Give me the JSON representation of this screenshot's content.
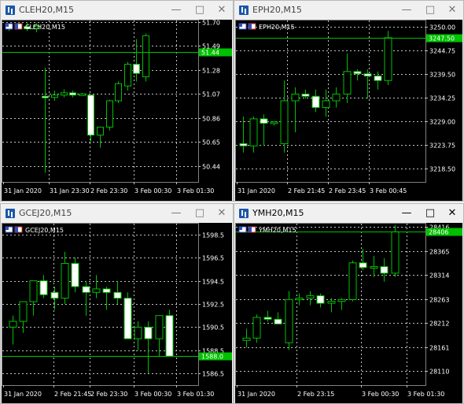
{
  "windows": [
    {
      "title": "CLEH20,M15",
      "chart_label": "CLEH20,M15",
      "price_ticks": [
        "51.70",
        "51.49",
        "51.28",
        "51.07",
        "50.86",
        "50.65",
        "50.44"
      ],
      "time_ticks": [
        "31 Jan 2020",
        "31 Jan 23:30",
        "2 Feb 23:30",
        "3 Feb 00:30",
        "3 Feb 01:30"
      ],
      "current_price": "51.44",
      "active": false
    },
    {
      "title": "EPH20,M15",
      "chart_label": "EPH20,M15",
      "price_ticks": [
        "3250.00",
        "3244.75",
        "3239.50",
        "3234.25",
        "3229.00",
        "3223.75",
        "3218.50"
      ],
      "time_ticks": [
        "31 Jan 2020",
        "2 Feb 21:45",
        "2 Feb 23:45",
        "3 Feb 00:45"
      ],
      "current_price": "3247.50",
      "active": false
    },
    {
      "title": "GCEJ20,M15",
      "chart_label": "GCEJ20,M15",
      "price_ticks": [
        "1598.5",
        "1596.5",
        "1594.5",
        "1592.5",
        "1590.5",
        "1588.5",
        "1586.5"
      ],
      "time_ticks": [
        "31 Jan 2020",
        "2 Feb 21:45",
        "2 Feb 23:30",
        "3 Feb 00:30",
        "3 Feb 01:30"
      ],
      "current_price": "1588.0",
      "active": false
    },
    {
      "title": "YMH20,M15",
      "chart_label": "YMH20,M15",
      "price_ticks": [
        "28416",
        "28365",
        "28314",
        "28263",
        "28212",
        "28161",
        "28110"
      ],
      "time_ticks": [
        "31 Jan 2020",
        "2 Feb 23:15",
        "3 Feb 00:30",
        "3 Feb 01:30"
      ],
      "current_price": "28406",
      "active": true
    }
  ],
  "chart_data": [
    {
      "type": "candlestick",
      "title": "CLEH20,M15",
      "y_range": [
        50.3,
        51.72
      ],
      "current_price": 51.44,
      "candles": [
        [
          51.65,
          51.69,
          51.62,
          51.67
        ],
        [
          51.67,
          51.7,
          51.64,
          51.66
        ],
        [
          51.66,
          51.7,
          51.62,
          51.64
        ],
        [
          51.64,
          51.69,
          51.61,
          51.67
        ],
        [
          51.05,
          51.3,
          50.38,
          51.04
        ],
        [
          51.04,
          51.1,
          51.01,
          51.06
        ],
        [
          51.06,
          51.11,
          51.04,
          51.08
        ],
        [
          51.08,
          51.1,
          51.04,
          51.06
        ],
        [
          51.07,
          51.08,
          51.06,
          51.07
        ],
        [
          51.06,
          51.06,
          50.65,
          50.71
        ],
        [
          50.71,
          50.78,
          50.6,
          50.78
        ],
        [
          50.78,
          51.02,
          50.75,
          51.01
        ],
        [
          51.01,
          51.18,
          50.99,
          51.16
        ],
        [
          51.14,
          51.35,
          51.1,
          51.33
        ],
        [
          51.33,
          51.55,
          51.18,
          51.25
        ],
        [
          51.22,
          51.6,
          51.18,
          51.58
        ]
      ]
    },
    {
      "type": "candlestick",
      "title": "EPH20,M15",
      "y_range": [
        3215.5,
        3251.5
      ],
      "current_price": 3247.5,
      "candles": [
        [
          3224.0,
          3230.0,
          3222.0,
          3223.5
        ],
        [
          3223.5,
          3230.0,
          3222.0,
          3229.5
        ],
        [
          3229.5,
          3230.5,
          3223.5,
          3228.5
        ],
        [
          3228.5,
          3229.0,
          3228.0,
          3228.8
        ],
        [
          3224.0,
          3238.0,
          3222.0,
          3233.5
        ],
        [
          3233.5,
          3236.5,
          3226.5,
          3235.0
        ],
        [
          3235.0,
          3236.0,
          3234.0,
          3234.5
        ],
        [
          3234.5,
          3236.0,
          3231.0,
          3232.0
        ],
        [
          3232.0,
          3236.0,
          3230.0,
          3233.5
        ],
        [
          3233.5,
          3236.5,
          3232.0,
          3235.0
        ],
        [
          3235.0,
          3244.0,
          3233.0,
          3240.0
        ],
        [
          3240.0,
          3240.5,
          3238.0,
          3239.5
        ],
        [
          3239.5,
          3240.5,
          3234.0,
          3239.0
        ],
        [
          3239.0,
          3240.0,
          3236.0,
          3238.0
        ],
        [
          3238.0,
          3249.0,
          3237.0,
          3247.5
        ]
      ]
    },
    {
      "type": "candlestick",
      "title": "GCEJ20,M15",
      "y_range": [
        1585.5,
        1599.5
      ],
      "current_price": 1588.0,
      "candles": [
        [
          1590.5,
          1591.5,
          1589.0,
          1591.0
        ],
        [
          1591.0,
          1592.5,
          1590.0,
          1592.7
        ],
        [
          1592.7,
          1594.5,
          1591.5,
          1594.5
        ],
        [
          1594.5,
          1595.0,
          1593.0,
          1593.3
        ],
        [
          1593.5,
          1594.0,
          1592.0,
          1593.0
        ],
        [
          1593.0,
          1597.0,
          1592.5,
          1596.0
        ],
        [
          1596.0,
          1596.5,
          1593.5,
          1594.0
        ],
        [
          1594.0,
          1594.5,
          1591.5,
          1593.5
        ],
        [
          1593.5,
          1595.0,
          1593.0,
          1593.8
        ],
        [
          1593.8,
          1594.0,
          1592.0,
          1593.5
        ],
        [
          1593.5,
          1594.5,
          1592.5,
          1593.0
        ],
        [
          1593.0,
          1593.5,
          1589.5,
          1589.5
        ],
        [
          1589.5,
          1591.0,
          1588.5,
          1590.5
        ],
        [
          1590.5,
          1591.0,
          1586.5,
          1589.5
        ],
        [
          1589.5,
          1591.0,
          1588.0,
          1591.5
        ],
        [
          1591.5,
          1592.0,
          1588.0,
          1588.0
        ]
      ]
    },
    {
      "type": "candlestick",
      "title": "YMH20,M15",
      "y_range": [
        28080,
        28425
      ],
      "current_price": 28406,
      "candles": [
        [
          28175,
          28200,
          28160,
          28180
        ],
        [
          28180,
          28230,
          28170,
          28224
        ],
        [
          28224,
          28238,
          28215,
          28220
        ],
        [
          28220,
          28235,
          28210,
          28210
        ],
        [
          28170,
          28280,
          28155,
          28262
        ],
        [
          28262,
          28275,
          28250,
          28265
        ],
        [
          28265,
          28280,
          28250,
          28270
        ],
        [
          28270,
          28275,
          28245,
          28254
        ],
        [
          28254,
          28265,
          28235,
          28258
        ],
        [
          28258,
          28265,
          28240,
          28262
        ],
        [
          28262,
          28345,
          28258,
          28340
        ],
        [
          28340,
          28370,
          28325,
          28330
        ],
        [
          28330,
          28355,
          28310,
          28332
        ],
        [
          28332,
          28350,
          28300,
          28318
        ],
        [
          28318,
          28420,
          28310,
          28406
        ]
      ]
    }
  ]
}
